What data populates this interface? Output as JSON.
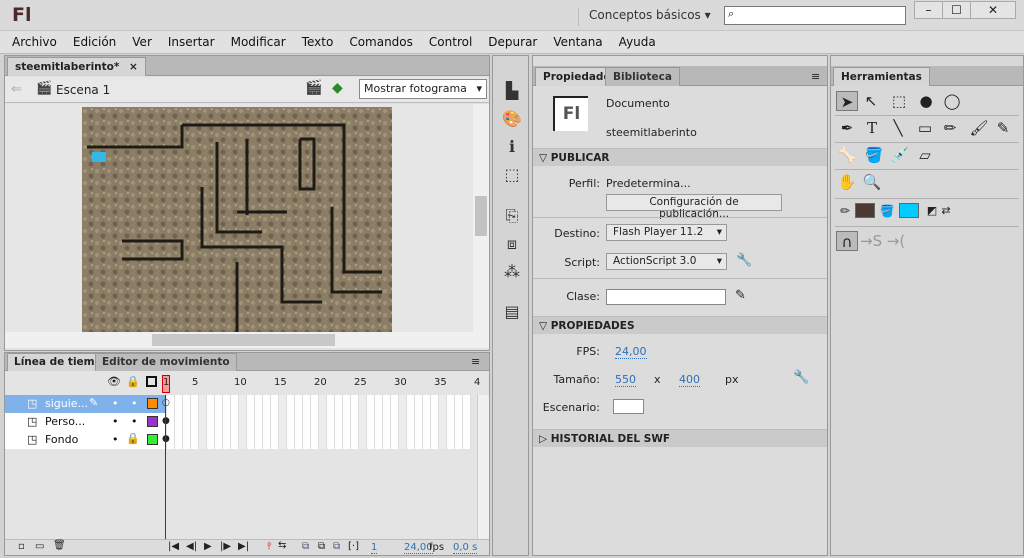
{
  "app": {
    "logo": "Fl",
    "workspace": "Conceptos básicos",
    "search_placeholder": ""
  },
  "window_buttons": [
    "–",
    "☐",
    "✕"
  ],
  "menu": [
    "Archivo",
    "Edición",
    "Ver",
    "Insertar",
    "Modificar",
    "Texto",
    "Comandos",
    "Control",
    "Depurar",
    "Ventana",
    "Ayuda"
  ],
  "document": {
    "tab": "steemitlaberinto*",
    "close": "×",
    "scene": "Escena 1",
    "view_select": "Mostrar fotograma"
  },
  "timeline": {
    "tabs": [
      "Línea de tiempo",
      "Editor de movimiento"
    ],
    "frame_numbers": [
      "1",
      "5",
      "10",
      "15",
      "20",
      "25",
      "30",
      "35",
      "4"
    ],
    "layers": [
      {
        "name": "siguie...",
        "color": "#ff8c00",
        "selected": true,
        "locked": false
      },
      {
        "name": "Perso...",
        "color": "#9933cc",
        "selected": false,
        "locked": false
      },
      {
        "name": "Fondo",
        "color": "#33ee33",
        "selected": false,
        "locked": true
      }
    ],
    "current_frame": "1",
    "fps": "24,00",
    "fps_unit": "fps",
    "time": "0,0 s"
  },
  "properties": {
    "tabs": [
      "Propiedades",
      "Biblioteca"
    ],
    "doc_icon": "Fl",
    "doc_type": "Documento",
    "doc_name": "steemitlaberinto",
    "publish_header": "PUBLICAR",
    "profile_label": "Perfil:",
    "profile_value": "Predetermina...",
    "publish_settings_button": "Configuración de publicación...",
    "target_label": "Destino:",
    "target_value": "Flash Player 11.2",
    "script_label": "Script:",
    "script_value": "ActionScript 3.0",
    "class_label": "Clase:",
    "class_value": "",
    "props_header": "PROPIEDADES",
    "fps_label": "FPS:",
    "fps_value": "24,00",
    "size_label": "Tamaño:",
    "width": "550",
    "x": "x",
    "height": "400",
    "unit": "px",
    "stage_label": "Escenario:",
    "stage_color": "#ffffff",
    "history_header": "HISTORIAL DEL SWF"
  },
  "tools": {
    "title": "Herramientas",
    "stroke_color": "#4a3a33",
    "fill_color": "#00ccff"
  }
}
